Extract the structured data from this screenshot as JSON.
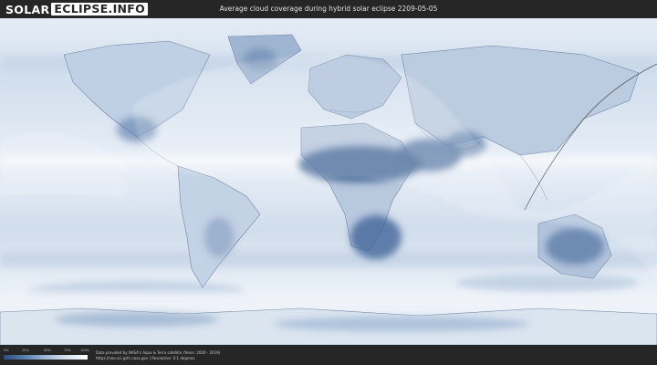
{
  "header": {
    "logo_word": "SOLAR",
    "logo_rest": "ECLIPSE.INFO",
    "title": "Average cloud coverage during hybrid solar eclipse 2209-05-05"
  },
  "map": {
    "kind": "world cloud coverage map",
    "colors": {
      "clear": "#2f5283",
      "cloudy": "#f4f8fc",
      "ocean_base": "#d8e4f0",
      "land_border": "#5e7291",
      "eclipse_visibility_overlay": "#ffffff",
      "path_line": "#3a3a3a"
    }
  },
  "legend": {
    "ticks": [
      "0%",
      "25%",
      "50%",
      "75%",
      "100%"
    ],
    "colors": [
      "#2c4e7e",
      "#5a7fae",
      "#9fb7d3",
      "#d6e1ee",
      "#ffffff"
    ]
  },
  "footer": {
    "credit_line_1": "Data provided by NASA's Aqua & Terra satellite (Years: 2000 - 2019)",
    "credit_line_2": "https://neo.sci.gsfc.nasa.gov | Resolution: 0.1 degrees"
  }
}
